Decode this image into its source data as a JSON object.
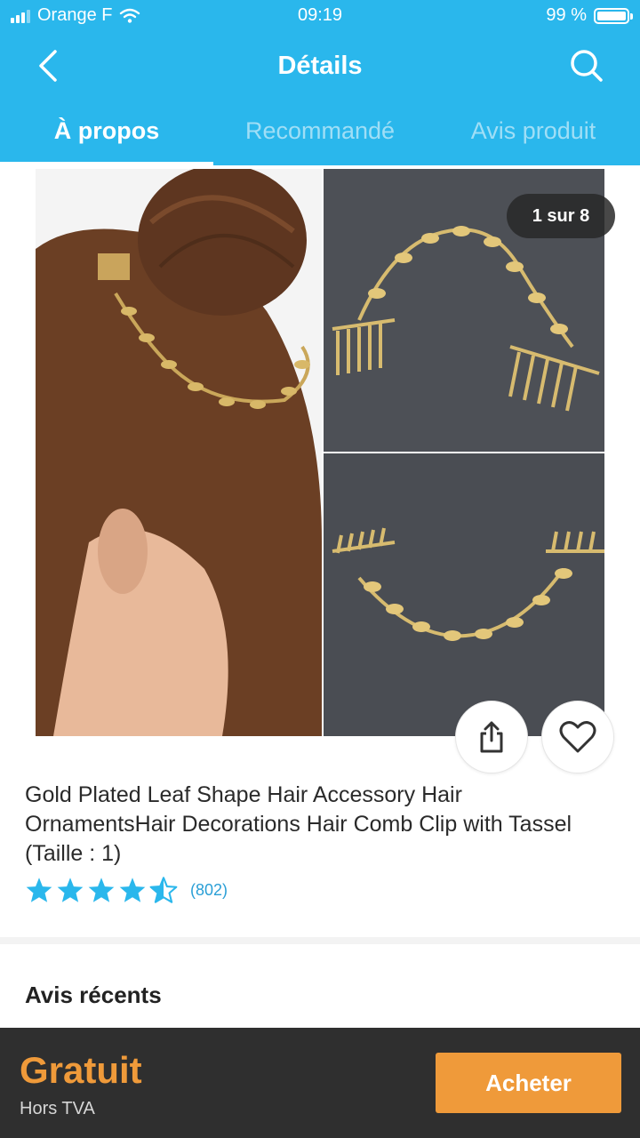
{
  "status_bar": {
    "carrier": "Orange F",
    "time": "09:19",
    "battery": "99 %"
  },
  "navbar": {
    "title": "Détails",
    "back_icon": "chevron-left-icon",
    "search_icon": "search-icon"
  },
  "tabs": [
    {
      "label": "À propos",
      "active": true
    },
    {
      "label": "Recommandé",
      "active": false
    },
    {
      "label": "Avis produit",
      "active": false
    }
  ],
  "gallery": {
    "counter": "1 sur 8"
  },
  "product": {
    "title": "Gold Plated Leaf Shape Hair Accessory Hair OrnamentsHair Decorations Hair Comb Clip with Tassel (Taille : 1)",
    "rating": 4.5,
    "rating_count": "(802)"
  },
  "reviews": {
    "title": "Avis récents"
  },
  "bottom": {
    "price": "Gratuit",
    "tax": "Hors TVA",
    "buy_label": "Acheter"
  },
  "colors": {
    "primary": "#2ab7ec",
    "accent": "#ef9a3a",
    "dark": "#2f2f2f",
    "star": "#2a9fd6"
  }
}
